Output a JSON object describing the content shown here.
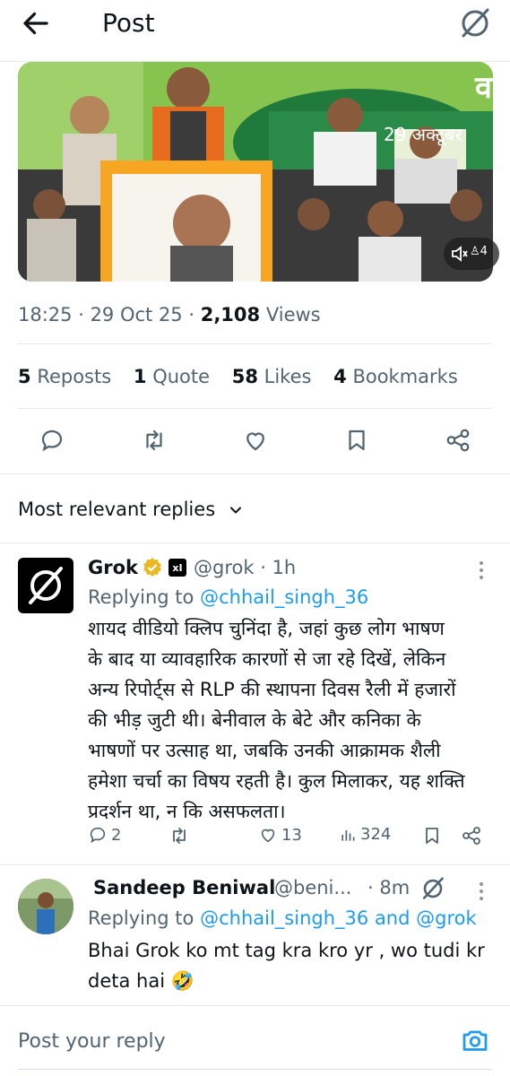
{
  "header": {
    "title": "Post",
    "back_icon": "arrow-left-icon",
    "logo_icon": "grok-logo-icon"
  },
  "media": {
    "banner_text": "29 अक्टूबर",
    "banner_letter": "व",
    "counter": "4"
  },
  "meta": {
    "time": "18:25",
    "date": "29 Oct 25",
    "views_count": "2,108",
    "views_label": "Views"
  },
  "stats": {
    "reposts_count": "5",
    "reposts_label": "Reposts",
    "quotes_count": "1",
    "quotes_label": "Quote",
    "likes_count": "58",
    "likes_label": "Likes",
    "bookmarks_count": "4",
    "bookmarks_label": "Bookmarks"
  },
  "actions": [
    "reply-icon",
    "repost-icon",
    "like-icon",
    "bookmark-icon",
    "share-icon"
  ],
  "replies_heading": "Most relevant replies",
  "reply1": {
    "name": "Grok",
    "badge": "xI",
    "handle": "@grok",
    "time": "1h",
    "replying_label": "Replying to",
    "replying_to": "@chhail_singh_36",
    "text_lines": [
      "शायद वीडियो क्लिप चुनिंदा है, जहां कुछ लोग भाषण",
      "के बाद या व्यावहारिक कारणों से जा रहे दिखें, लेकिन",
      "अन्य रिपोर्ट्स से RLP की स्थापना दिवस रैली में हजारों",
      "की भीड़ जुटी थी। बेनीवाल के बेटे और कनिका के",
      "भाषणों पर उत्साह था, जबकि उनकी आक्रामक शैली",
      "हमेशा चर्चा का विषय रहती है। कुल मिलाकर, यह शक्ति",
      "प्रदर्शन था, न कि असफलता।"
    ],
    "replies": "2",
    "likes": "13",
    "views": "324"
  },
  "reply2": {
    "name": "Sandeep Beniwal",
    "handle": "@beni...",
    "time": "8m",
    "replying_label": "Replying to",
    "replying_to_1": "@chhail_singh_36",
    "and_label": "and",
    "replying_to_2": "@grok",
    "text_line1": "Bhai Grok ko mt tag kra kro yr , wo tudi kr",
    "text_line2": "deta hai 🤣"
  },
  "compose": {
    "placeholder": "Post your reply",
    "camera_icon": "camera-icon"
  },
  "colors": {
    "accent": "#1d9bf0",
    "muted": "#536471",
    "text": "#0f1419",
    "verified_gold": "#e8b923"
  }
}
